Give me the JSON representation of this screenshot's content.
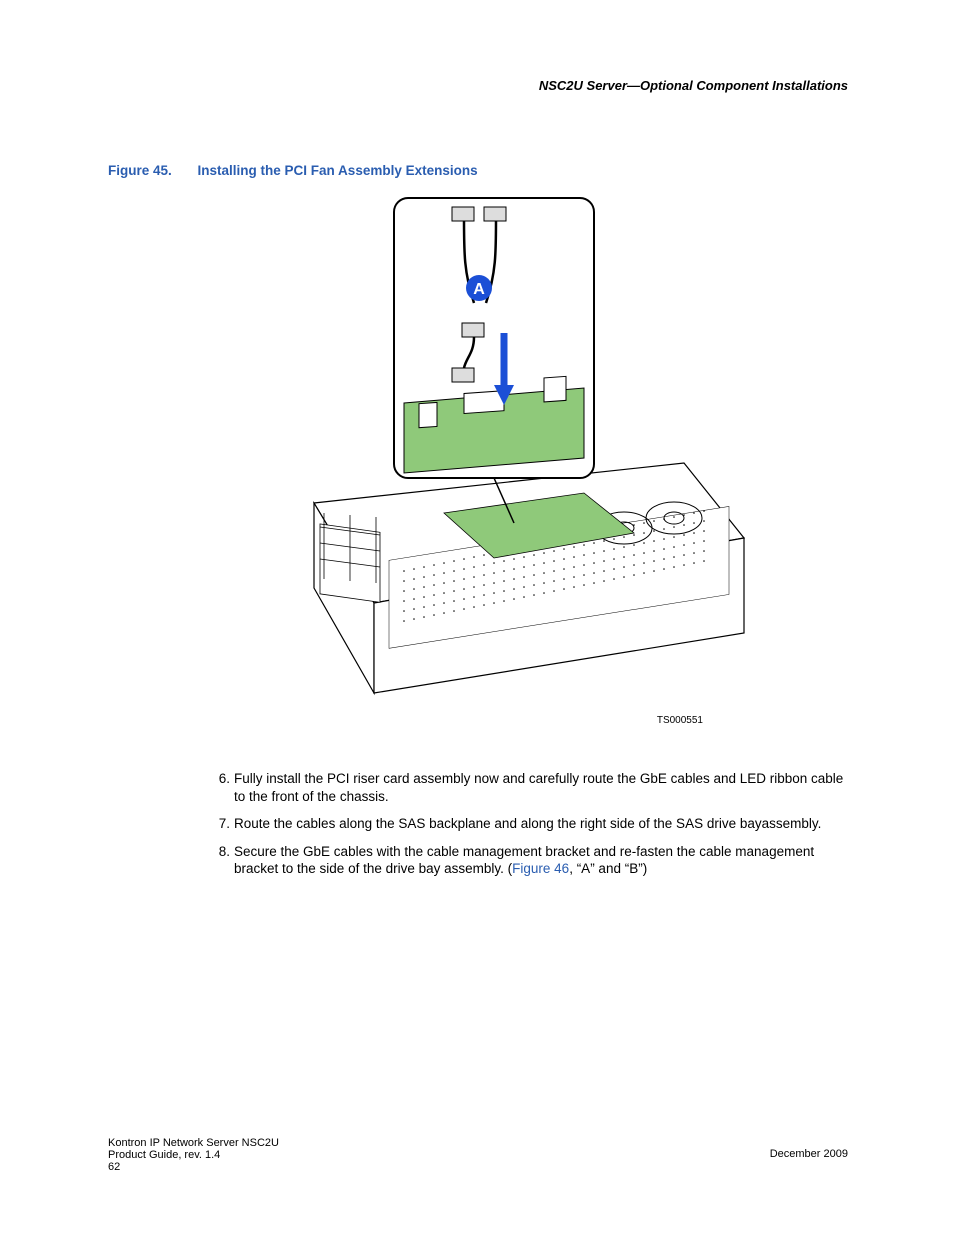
{
  "header": {
    "running_title": "NSC2U Server—Optional Component Installations"
  },
  "figure": {
    "label": "Figure 45.",
    "title": "Installing the PCI Fan Assembly Extensions",
    "callout": "A",
    "id_text": "TS000551"
  },
  "steps": [
    {
      "num": "6.",
      "text_before": "Fully install the PCI riser card assembly now and carefully route the GbE cables and LED ribbon cable to the front of the chassis.",
      "xref": "",
      "text_after": ""
    },
    {
      "num": "7.",
      "text_before": "Route the cables along the SAS backplane and along the right side of the SAS drive bayassembly.",
      "xref": "",
      "text_after": ""
    },
    {
      "num": "8.",
      "text_before": "Secure the GbE cables with the cable management bracket and re-fasten the cable management bracket to the side of the drive bay assembly. (",
      "xref": "Figure 46",
      "text_after": ", “A” and “B”)"
    }
  ],
  "footer": {
    "line1": "Kontron IP Network Server NSC2U",
    "line2": "Product Guide, rev. 1.4",
    "page": "62",
    "date": "December 2009"
  }
}
